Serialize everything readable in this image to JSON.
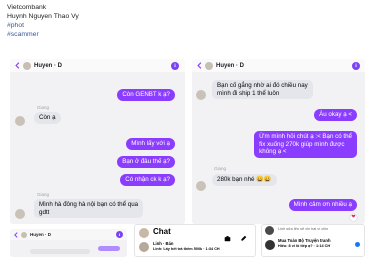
{
  "header": {
    "line1": "Vietcombank",
    "line2": "Huynh Nguyen Thao Vy",
    "tag1": "#phot",
    "tag2": "#scammer"
  },
  "left_chat": {
    "contact_name": "Huyen · D",
    "messages": [
      {
        "dir": "out",
        "text": "Còn GENBT k ạ?"
      },
      {
        "dir": "in",
        "sender": "Giang",
        "text": "Còn ạ"
      },
      {
        "dir": "out",
        "text": "Mình lấy với ạ"
      },
      {
        "dir": "out",
        "text": "Bạn ở đâu thế ạ?"
      },
      {
        "dir": "out",
        "text": "Có nhận ck k ạ?"
      },
      {
        "dir": "in",
        "sender": "Giang",
        "text_line1": "Mình hà đông hà nội bạn có thể qua",
        "text_line2": "gdtt"
      }
    ]
  },
  "right_chat": {
    "contact_name": "Huyen · D",
    "messages": [
      {
        "dir": "in",
        "text_line1": "Bạn cố gắng nhờ ai đó chiều nay",
        "text_line2": "mình đi ship 1 thể luôn"
      },
      {
        "dir": "out",
        "text": "Àu okay ạ <"
      },
      {
        "dir": "out",
        "text_line1": "Ừm mình hỏi chút ạ :< Bạn có thể",
        "text_line2": "fix xuống 270k giúp mình được",
        "text_line3": "không ạ <"
      },
      {
        "dir": "in",
        "sender": "Giang",
        "text": "280k bạn nhé 😀😀"
      },
      {
        "dir": "out",
        "text": "Mình cảm ơn nhiều ạ"
      }
    ],
    "reaction": "❤"
  },
  "bottom_left_chat": {
    "contact_name": "Huyen · D"
  },
  "bottom_mid_chat": {
    "title": "Chat",
    "item_name": "Linh · Bán",
    "item_preview": "Linh: Lấy hết trả thêm 500k · 1:34 CH"
  },
  "bottom_right_chat": {
    "item1": "Linh sửa tên sẽ xin hai vì chin",
    "item2_title": "Mua Toàn Bộ Truyện tranh",
    "item2_sub": "Hiếu: 8 vi lô tiếp ạ? · 1:14 CH"
  },
  "colors": {
    "outgoing_bubble": "#8b3dff",
    "incoming_bubble": "#e4e6eb",
    "hashtag": "#385898",
    "info_icon": "#7b42f6"
  }
}
